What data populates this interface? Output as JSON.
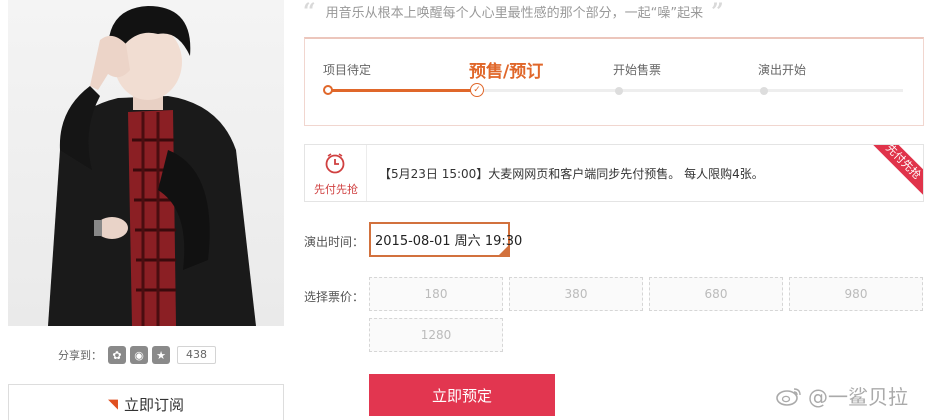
{
  "slogan": {
    "open_quote": "“",
    "text": "用音乐从根本上唤醒每个人心里最性感的那个部分，一起“噪”起来",
    "close_quote": "”"
  },
  "progress": {
    "stages": [
      {
        "label": "项目待定",
        "state": "done"
      },
      {
        "label": "预售/预订",
        "state": "current"
      },
      {
        "label": "开始售票",
        "state": "pending"
      },
      {
        "label": "演出开始",
        "state": "pending"
      }
    ]
  },
  "notice": {
    "icon_label": "先付先抢",
    "text": "【5月23日 15:00】大麦网网页和客户端同步先付预售。 每人限购4张。",
    "corner_badge": "先付先抢"
  },
  "show_time": {
    "label": "演出时间：",
    "selected": "2015-08-01 周六 19:30"
  },
  "tickets": {
    "label": "选择票价：",
    "prices": [
      "180",
      "380",
      "680",
      "980",
      "1280"
    ]
  },
  "buy_button": "立即预定",
  "share": {
    "label": "分享到：",
    "count": "438"
  },
  "subscribe": "立即订阅",
  "watermark": "@一鲨贝拉",
  "colors": {
    "accent": "#e0672a",
    "buy_button": "#e23650",
    "notice_red": "#d04040"
  }
}
